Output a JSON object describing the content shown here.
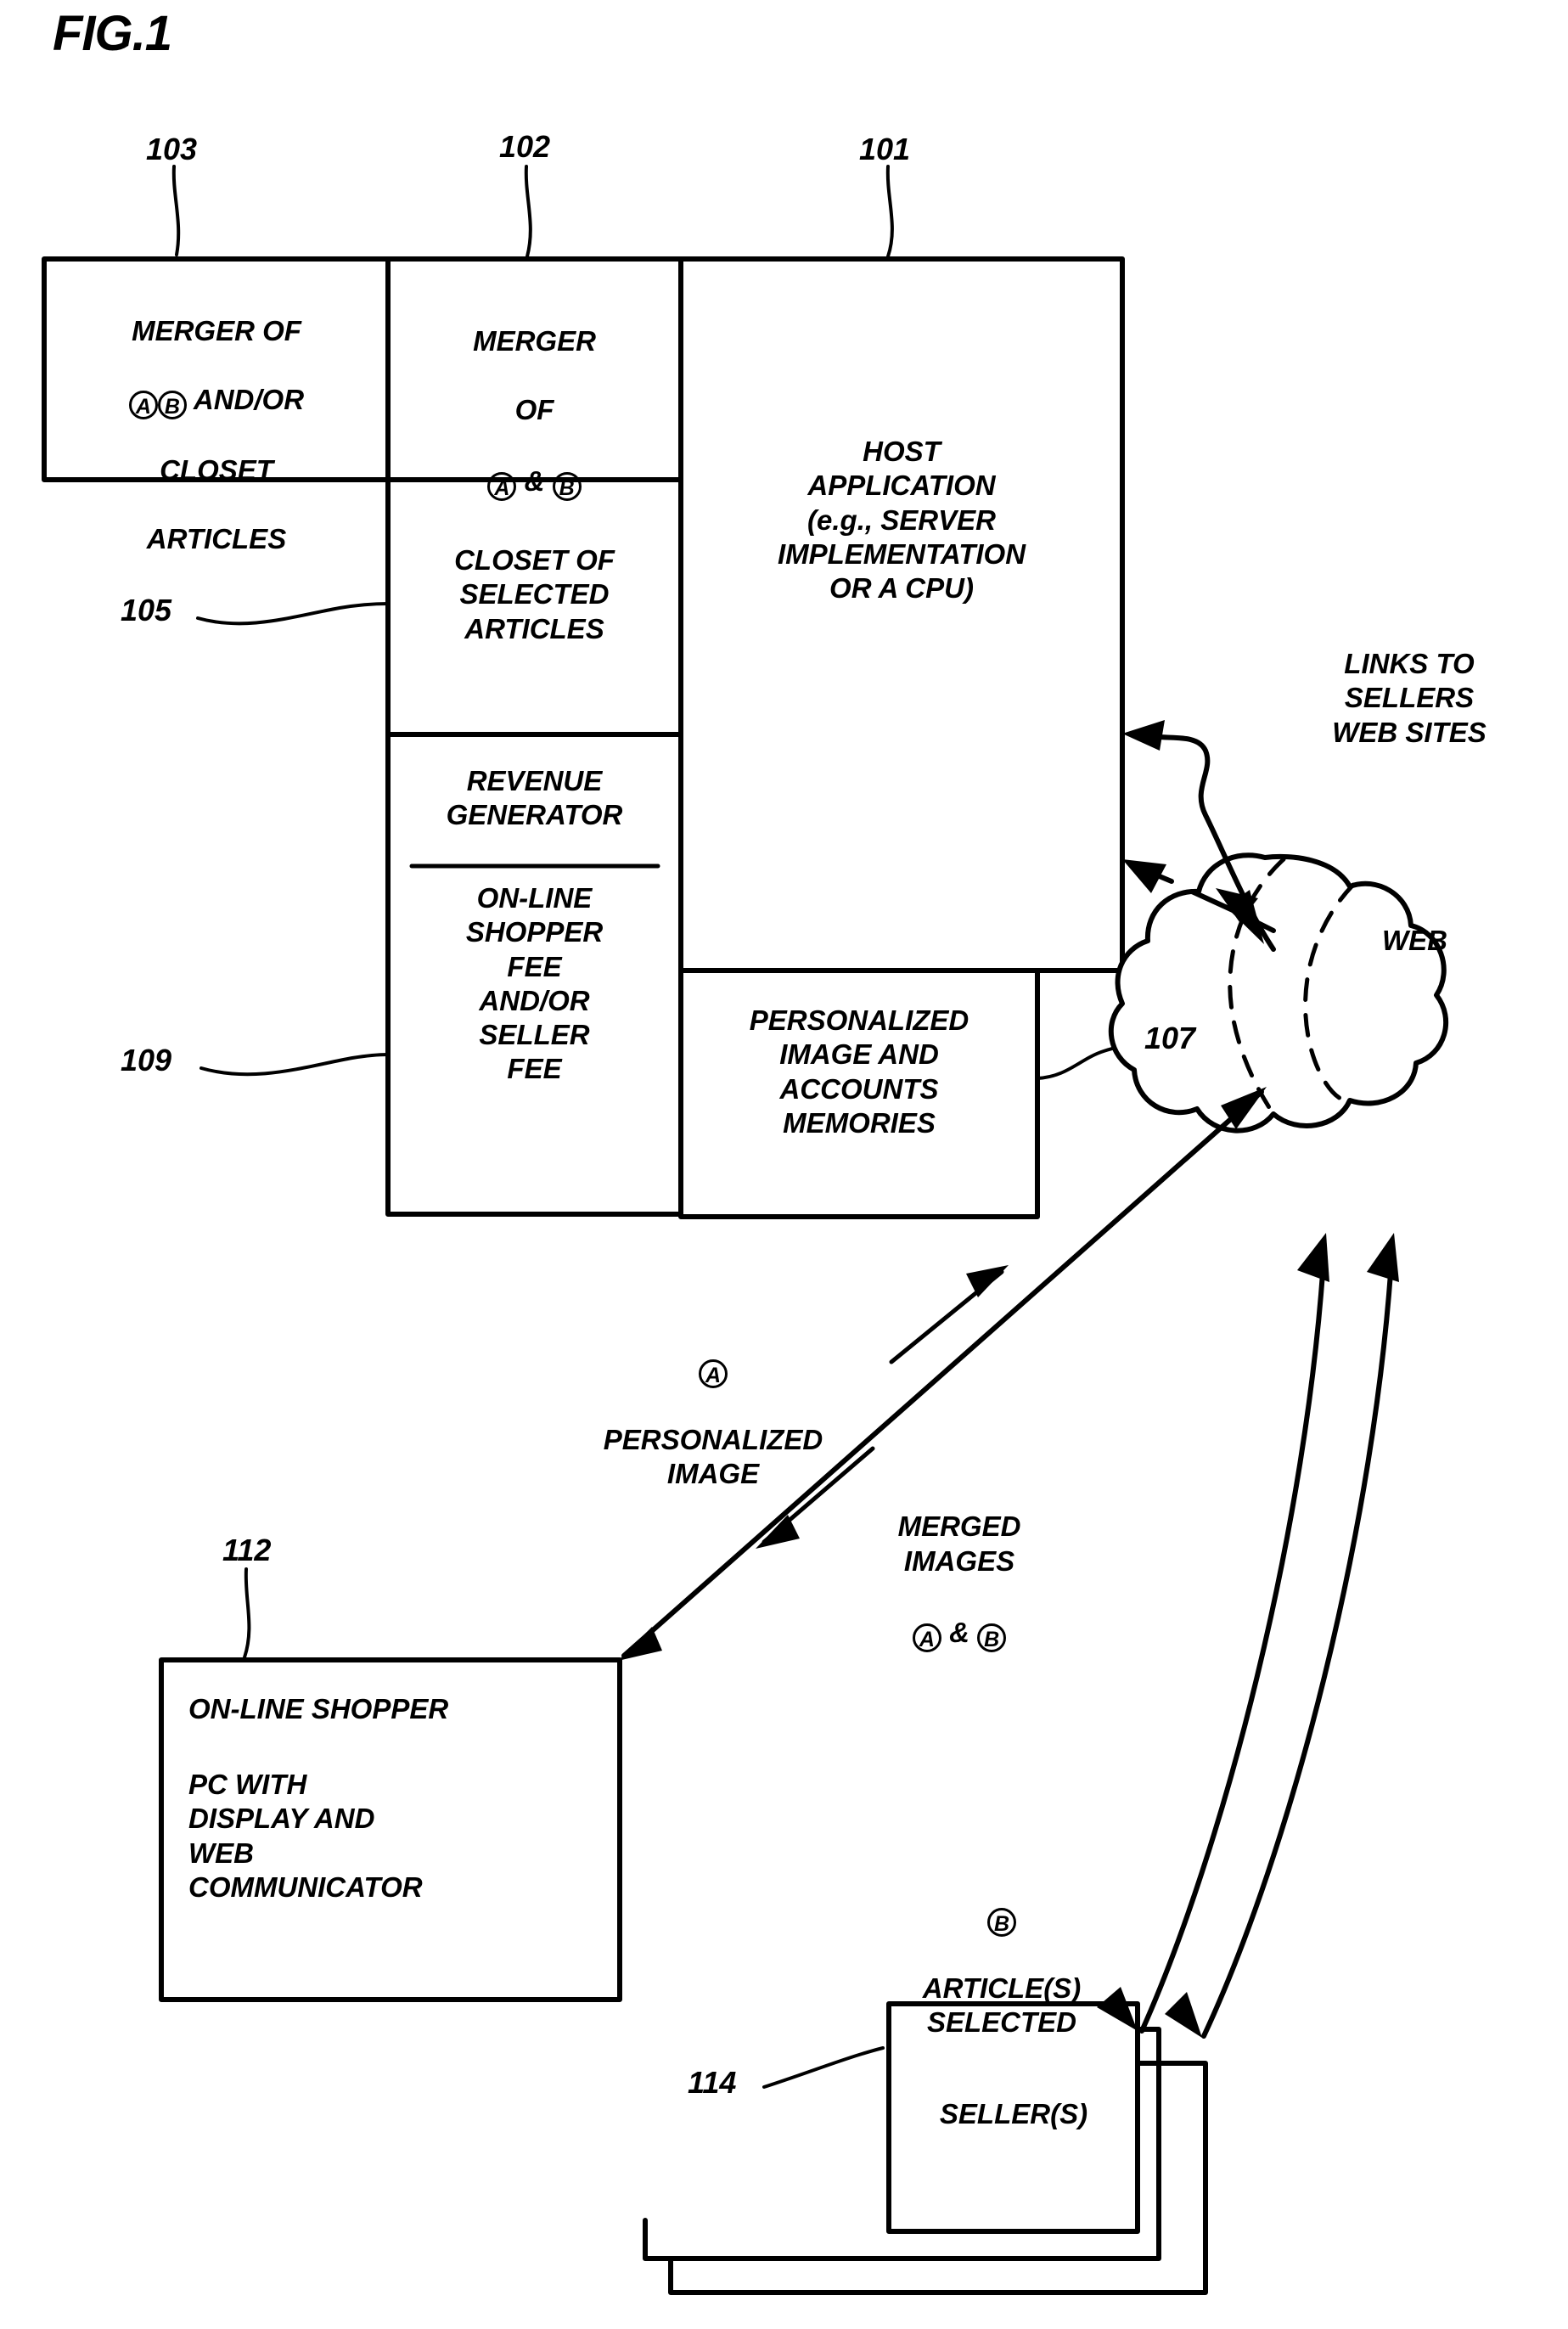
{
  "figure": {
    "title": "FIG.1"
  },
  "reference_numerals": {
    "n101": "101",
    "n102": "102",
    "n103": "103",
    "n105": "105",
    "n107": "107",
    "n109": "109",
    "n112": "112",
    "n114": "114"
  },
  "boxes": {
    "merger_ab_closet": {
      "line1": "MERGER OF",
      "line2_circle_a": "A",
      "line2_circle_b": "B",
      "line2_text": "AND/OR",
      "line3": "CLOSET",
      "line4": "ARTICLES"
    },
    "merger_a_b": {
      "line1": "MERGER",
      "line2": "OF",
      "circle_a": "A",
      "ampersand": "&",
      "circle_b": "B"
    },
    "closet_selected": {
      "text": "CLOSET OF\nSELECTED\nARTICLES"
    },
    "revenue_generator": {
      "title": "REVENUE\nGENERATOR",
      "detail": "ON-LINE\nSHOPPER\nFEE\nAND/OR\nSELLER\nFEE"
    },
    "host_application": {
      "text": "HOST\nAPPLICATION\n(e.g., SERVER\nIMPLEMENTATION\nOR A CPU)"
    },
    "personalized_memories": {
      "text": "PERSONALIZED\nIMAGE AND\nACCOUNTS\nMEMORIES"
    },
    "online_shopper_pc": {
      "heading": "ON-LINE SHOPPER",
      "body": "PC WITH\nDISPLAY AND\nWEB\nCOMMUNICATOR"
    },
    "sellers": {
      "text": "SELLER(S)"
    }
  },
  "free_labels": {
    "links_to_sellers": "LINKS TO\nSELLERS\nWEB SITES",
    "web_cloud": "WEB",
    "personalized_image": {
      "circle": "A",
      "text": "PERSONALIZED\nIMAGE"
    },
    "merged_images": {
      "text": "MERGED\nIMAGES",
      "circle_a": "A",
      "ampersand": "&",
      "circle_b": "B"
    },
    "articles_selected": {
      "circle": "B",
      "text": "ARTICLE(S)\nSELECTED"
    }
  },
  "colors": {
    "ink": "#000000",
    "paper": "#ffffff"
  }
}
